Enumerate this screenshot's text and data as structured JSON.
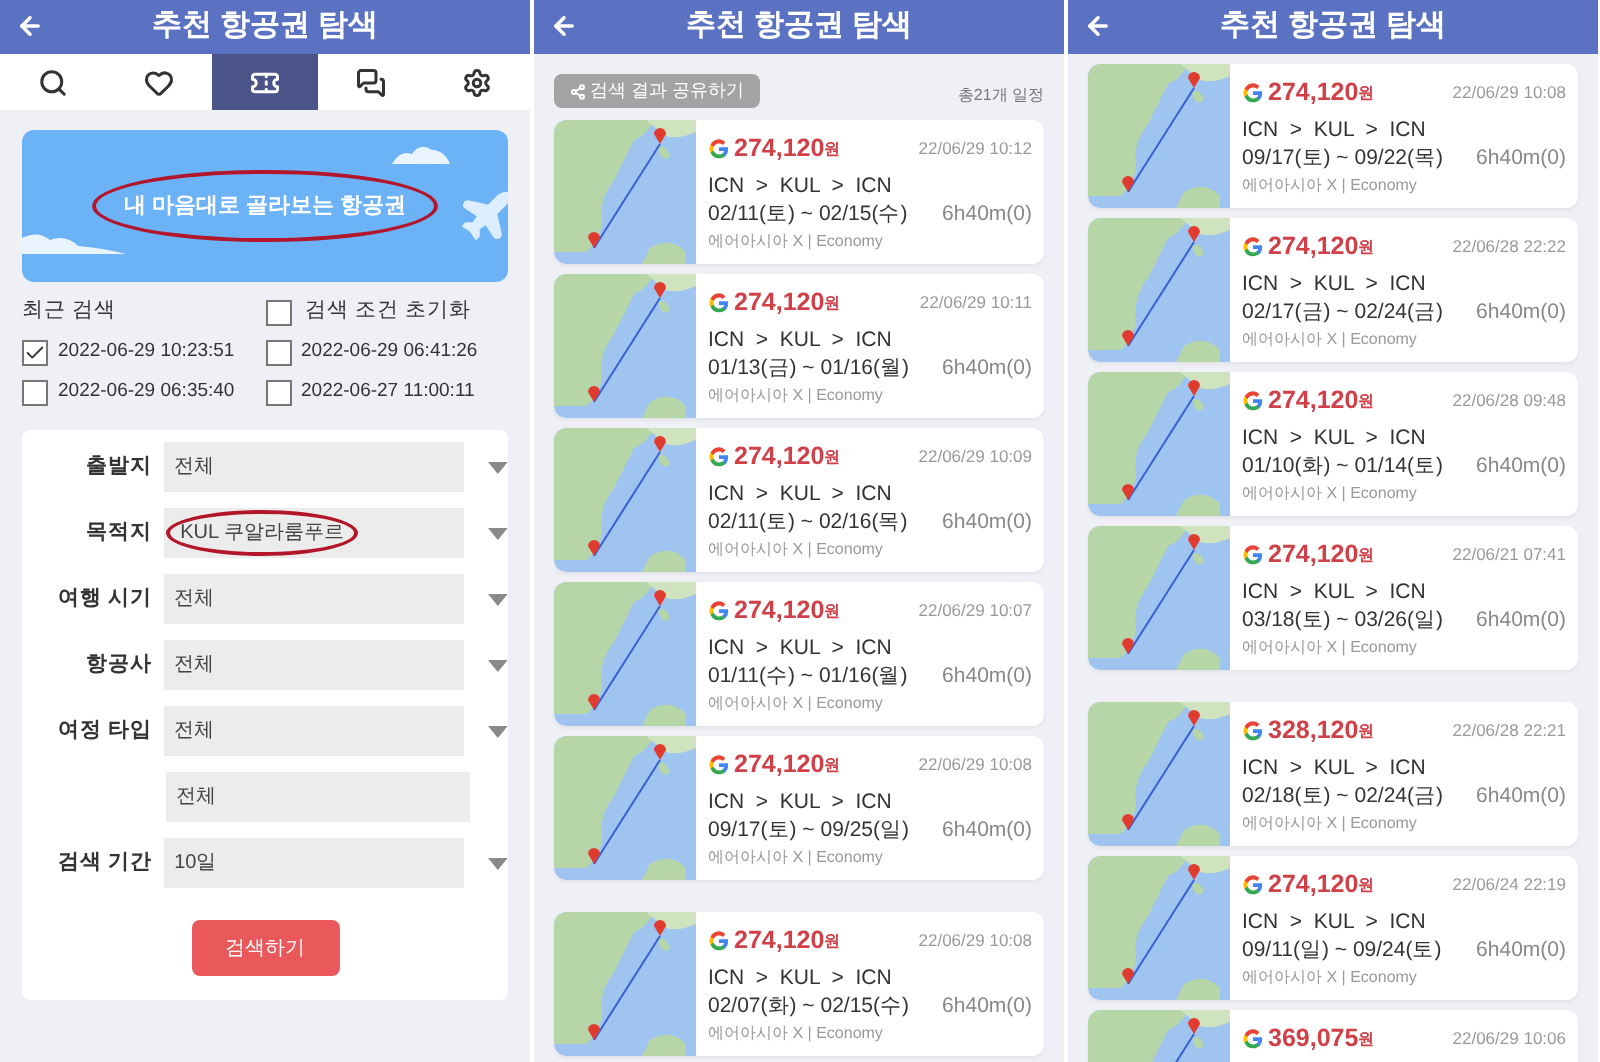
{
  "panels": [
    {
      "kind": "search",
      "header": {
        "title": "추천 항공권 탐색"
      },
      "tabs": [
        {
          "kind": "search",
          "selected": false
        },
        {
          "kind": "heart",
          "selected": false
        },
        {
          "kind": "ticket",
          "selected": true
        },
        {
          "kind": "chat",
          "selected": false
        },
        {
          "kind": "settings",
          "selected": false
        }
      ],
      "banner": {
        "text": "내 마음대로 골라보는 항공권",
        "circled": true
      },
      "recent": {
        "label": "최근 검색",
        "reset": {
          "label": "검색 조건 초기화",
          "checked": false
        },
        "items": [
          {
            "label": "2022-06-29 10:23:51",
            "checked": true
          },
          {
            "label": "2022-06-29 06:41:26",
            "checked": false
          },
          {
            "label": "2022-06-29 06:35:40",
            "checked": false
          },
          {
            "label": "2022-06-27 11:00:11",
            "checked": false
          }
        ]
      },
      "form": {
        "fields": [
          {
            "kind": "select",
            "label": "출발지",
            "value": "전체",
            "circled": false
          },
          {
            "kind": "select",
            "label": "목적지",
            "value": "KUL 쿠알라룸푸르",
            "circled": true
          },
          {
            "kind": "select",
            "label": "여행 시기",
            "value": "전체",
            "circled": false
          },
          {
            "kind": "select",
            "label": "항공사",
            "value": "전체",
            "circled": false
          },
          {
            "kind": "select",
            "label": "여정 타입",
            "value": "전체",
            "circled": false
          },
          {
            "kind": "plain",
            "value": "전체",
            "circled": false
          },
          {
            "kind": "select",
            "label": "검색 기간",
            "value": "10일",
            "circled": false
          }
        ],
        "submit": "검색하기"
      }
    },
    {
      "kind": "results",
      "header": {
        "title": "추천 항공권 탐색"
      },
      "share": {
        "label": "검색 결과 공유하기"
      },
      "total": "총21개 일정",
      "card_groups": [
        [
          {
            "price": "274,120",
            "unit": "원",
            "time": "22/06/29 10:12",
            "route": "ICN  >  KUL  >  ICN",
            "dates": "02/11(토) ~ 02/15(수)",
            "duration": "6h40m(0)",
            "airline": "에어아시아 X | Economy"
          },
          {
            "price": "274,120",
            "unit": "원",
            "time": "22/06/29 10:11",
            "route": "ICN  >  KUL  >  ICN",
            "dates": "01/13(금) ~ 01/16(월)",
            "duration": "6h40m(0)",
            "airline": "에어아시아 X | Economy"
          },
          {
            "price": "274,120",
            "unit": "원",
            "time": "22/06/29 10:09",
            "route": "ICN  >  KUL  >  ICN",
            "dates": "02/11(토) ~ 02/16(목)",
            "duration": "6h40m(0)",
            "airline": "에어아시아 X | Economy"
          },
          {
            "price": "274,120",
            "unit": "원",
            "time": "22/06/29 10:07",
            "route": "ICN  >  KUL  >  ICN",
            "dates": "01/11(수) ~ 01/16(월)",
            "duration": "6h40m(0)",
            "airline": "에어아시아 X | Economy"
          },
          {
            "price": "274,120",
            "unit": "원",
            "time": "22/06/29 10:08",
            "route": "ICN  >  KUL  >  ICN",
            "dates": "09/17(토) ~ 09/25(일)",
            "duration": "6h40m(0)",
            "airline": "에어아시아 X | Economy"
          }
        ],
        [
          {
            "price": "274,120",
            "unit": "원",
            "time": "22/06/29 10:08",
            "route": "ICN  >  KUL  >  ICN",
            "dates": "02/07(화) ~ 02/15(수)",
            "duration": "6h40m(0)",
            "airline": "에어아시아 X | Economy"
          }
        ]
      ]
    },
    {
      "kind": "results",
      "header": {
        "title": "추천 항공권 탐색"
      },
      "card_groups": [
        [
          {
            "price": "274,120",
            "unit": "원",
            "time": "22/06/29 10:08",
            "route": "ICN  >  KUL  >  ICN",
            "dates": "09/17(토) ~ 09/22(목)",
            "duration": "6h40m(0)",
            "airline": "에어아시아 X | Economy"
          },
          {
            "price": "274,120",
            "unit": "원",
            "time": "22/06/28 22:22",
            "route": "ICN  >  KUL  >  ICN",
            "dates": "02/17(금) ~ 02/24(금)",
            "duration": "6h40m(0)",
            "airline": "에어아시아 X | Economy"
          },
          {
            "price": "274,120",
            "unit": "원",
            "time": "22/06/28 09:48",
            "route": "ICN  >  KUL  >  ICN",
            "dates": "01/10(화) ~ 01/14(토)",
            "duration": "6h40m(0)",
            "airline": "에어아시아 X | Economy"
          },
          {
            "price": "274,120",
            "unit": "원",
            "time": "22/06/21 07:41",
            "route": "ICN  >  KUL  >  ICN",
            "dates": "03/18(토) ~ 03/26(일)",
            "duration": "6h40m(0)",
            "airline": "에어아시아 X | Economy"
          }
        ],
        [
          {
            "price": "328,120",
            "unit": "원",
            "time": "22/06/28 22:21",
            "route": "ICN  >  KUL  >  ICN",
            "dates": "02/18(토) ~ 02/24(금)",
            "duration": "6h40m(0)",
            "airline": "에어아시아 X | Economy"
          },
          {
            "price": "274,120",
            "unit": "원",
            "time": "22/06/24 22:19",
            "route": "ICN  >  KUL  >  ICN",
            "dates": "09/11(일) ~ 09/24(토)",
            "duration": "6h40m(0)",
            "airline": "에어아시아 X | Economy"
          },
          {
            "price": "369,075",
            "unit": "원",
            "time": "22/06/29 10:06"
          }
        ]
      ]
    }
  ]
}
